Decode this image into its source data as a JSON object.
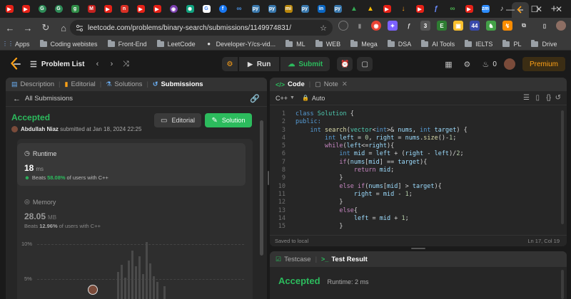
{
  "browser": {
    "url": "leetcode.com/problems/binary-search/submissions/1149974831/",
    "bookmarks": [
      "Apps",
      "Coding webistes",
      "Front-End",
      "LeetCode",
      "Developer-Y/cs-vid...",
      "ML",
      "WEB",
      "Mega",
      "DSA",
      "AI Tools",
      "IELTS",
      "PL",
      "Drive"
    ]
  },
  "header": {
    "problem_list": "Problem List",
    "run": "Run",
    "submit": "Submit",
    "streak": "0",
    "premium": "Premium"
  },
  "left_panel": {
    "tabs": [
      "Description",
      "Editorial",
      "Solutions",
      "Submissions"
    ],
    "all_submissions": "All Submissions",
    "status": "Accepted",
    "author": "Abdullah Niaz",
    "submitted_text": "submitted at Jan 18, 2024 22:25",
    "editorial_btn": "Editorial",
    "solution_btn": "Solution",
    "runtime_label": "Runtime",
    "runtime_value": "18",
    "runtime_unit": "ms",
    "runtime_beats_prefix": "Beats",
    "runtime_beats_pct": "58.08%",
    "runtime_beats_suffix": "of users with C++",
    "memory_label": "Memory",
    "memory_value": "28.05",
    "memory_unit": "MB",
    "memory_beats_prefix": "Beats",
    "memory_beats_pct": "12.96%",
    "memory_beats_suffix": "of users with C++",
    "chart_ticks": [
      "10%",
      "5%"
    ]
  },
  "code_panel": {
    "tabs": [
      "Code",
      "Note"
    ],
    "language": "C++",
    "mode": "Auto",
    "saved": "Saved to local",
    "cursor": "Ln 17, Col 19"
  },
  "code_lines": [
    "1",
    "2",
    "3",
    "4",
    "5",
    "6",
    "7",
    "8",
    "9",
    "10",
    "11",
    "12",
    "13",
    "14",
    "15"
  ],
  "result_panel": {
    "tabs": [
      "Testcase",
      "Test Result"
    ],
    "status": "Accepted",
    "runtime": "Runtime: 2 ms"
  },
  "colors": {
    "accent_green": "#2cbb5d",
    "premium_orange": "#ffa116"
  }
}
